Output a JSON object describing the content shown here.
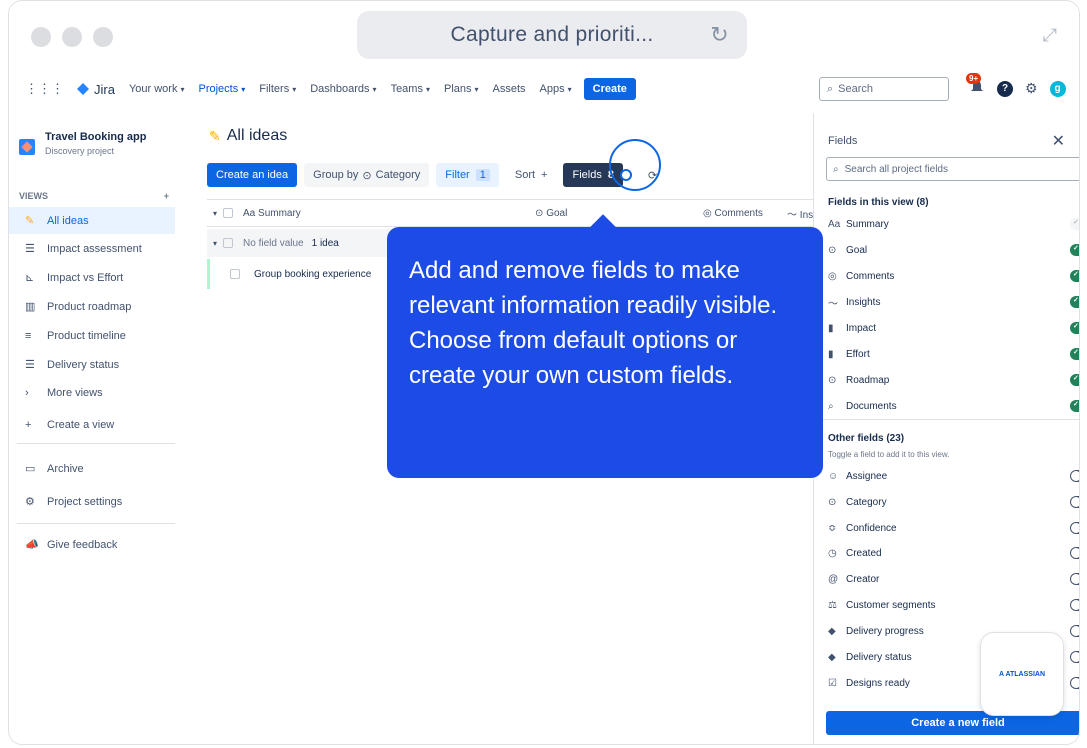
{
  "browser": {
    "url_title": "Capture and prioriti...",
    "reload_icon": "reload-icon",
    "expand_icon": "expand-icon"
  },
  "topnav": {
    "product": "Jira",
    "items": [
      "Your work",
      "Projects",
      "Filters",
      "Dashboards",
      "Teams",
      "Plans",
      "Assets",
      "Apps"
    ],
    "active_item": "Projects",
    "create_label": "Create",
    "search_placeholder": "Search",
    "notifications_badge": "9+",
    "help_label": "?",
    "avatar_initial": "g"
  },
  "sidebar": {
    "project_name": "Travel Booking app",
    "project_type": "Discovery project",
    "views_header": "VIEWS",
    "add_label": "+",
    "views": [
      {
        "label": "All ideas",
        "icon": "idea-icon",
        "active": true
      },
      {
        "label": "Impact assessment",
        "icon": "list-icon"
      },
      {
        "label": "Impact vs Effort",
        "icon": "matrix-icon"
      },
      {
        "label": "Product roadmap",
        "icon": "board-icon"
      },
      {
        "label": "Product timeline",
        "icon": "timeline-icon"
      },
      {
        "label": "Delivery status",
        "icon": "list-icon"
      },
      {
        "label": "More views",
        "icon": "chevron-right-icon"
      },
      {
        "label": "Create a view",
        "icon": "plus-icon"
      }
    ],
    "archive": "Archive",
    "settings": "Project settings",
    "feedback": "Give feedback"
  },
  "main": {
    "title": "All ideas",
    "toolbar": {
      "create_idea": "Create an idea",
      "group_by": "Group by",
      "group_value": "Category",
      "filter": "Filter",
      "filter_count": "1",
      "sort": "Sort",
      "sort_plus": "+",
      "fields": "Fields",
      "fields_count": "8"
    },
    "columns": [
      "Aa Summary",
      "Goal",
      "Comments",
      "Insi"
    ],
    "group": {
      "label": "No field value",
      "count": "1 idea"
    },
    "rows": [
      "Group booking experience"
    ]
  },
  "tooltip": {
    "text": "Add and remove fields to make relevant information readily visible. Choose from default options or create your own custom fields."
  },
  "panel": {
    "title": "Fields",
    "search_placeholder": "Search all project fields",
    "in_view_header": "Fields in this view (8)",
    "in_view": [
      {
        "label": "Summary",
        "icon": "text-icon",
        "state": "disabled"
      },
      {
        "label": "Goal",
        "icon": "goal-icon",
        "state": "on"
      },
      {
        "label": "Comments",
        "icon": "comment-icon",
        "state": "on"
      },
      {
        "label": "Insights",
        "icon": "insights-icon",
        "state": "on"
      },
      {
        "label": "Impact",
        "icon": "impact-icon",
        "state": "on"
      },
      {
        "label": "Effort",
        "icon": "effort-icon",
        "state": "on"
      },
      {
        "label": "Roadmap",
        "icon": "roadmap-icon",
        "state": "on"
      },
      {
        "label": "Documents",
        "icon": "document-icon",
        "state": "on"
      }
    ],
    "other_header": "Other fields (23)",
    "other_hint": "Toggle a field to add it to this view.",
    "other": [
      {
        "label": "Assignee",
        "icon": "user-icon"
      },
      {
        "label": "Category",
        "icon": "category-icon"
      },
      {
        "label": "Confidence",
        "icon": "confidence-icon"
      },
      {
        "label": "Created",
        "icon": "clock-icon"
      },
      {
        "label": "Creator",
        "icon": "at-icon"
      },
      {
        "label": "Customer segments",
        "icon": "segments-icon"
      },
      {
        "label": "Delivery progress",
        "icon": "diamond-icon"
      },
      {
        "label": "Delivery status",
        "icon": "diamond-icon"
      },
      {
        "label": "Designs ready",
        "icon": "checkbox-icon"
      }
    ],
    "create_field": "Create a new field"
  },
  "atlassian_badge": "A ATLASSIAN",
  "colors": {
    "accent": "#0c66e4",
    "tooltip": "#1d4be5",
    "toggle_on": "#1f845a",
    "toggle_off": "#44546f"
  }
}
